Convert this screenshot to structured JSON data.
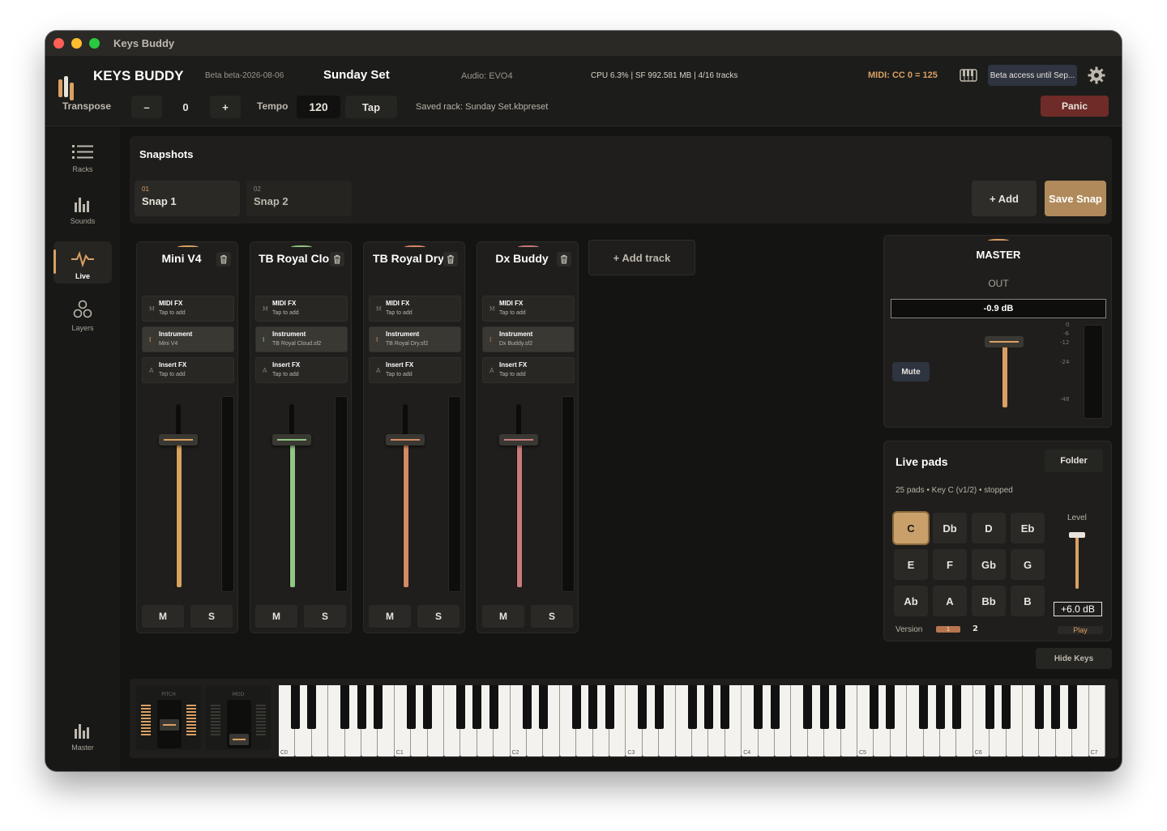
{
  "window": {
    "title": "Keys Buddy"
  },
  "header": {
    "brand": "KEYS BUDDY",
    "version": "Beta beta-2026-08-06",
    "set_name": "Sunday Set",
    "audio": "Audio: EVO4",
    "stats": "CPU 6.3% | SF 992.581 MB | 4/16 tracks",
    "midi": "MIDI: CC 0 = 125",
    "beta_button": "Beta access until Sep...",
    "transpose_label": "Transpose",
    "transpose_minus": "–",
    "transpose_value": "0",
    "transpose_plus": "+",
    "tempo_label": "Tempo",
    "tempo_value": "120",
    "tap_label": "Tap",
    "saved_rack": "Saved rack: Sunday Set.kbpreset",
    "panic_label": "Panic",
    "accent": "#d9a064",
    "panic_color": "#6e2b28"
  },
  "sidebar": {
    "items": [
      {
        "label": "Racks",
        "icon": "list-icon"
      },
      {
        "label": "Sounds",
        "icon": "bars-icon"
      },
      {
        "label": "Live",
        "icon": "pulse-icon"
      },
      {
        "label": "Layers",
        "icon": "layers-icon"
      }
    ],
    "master_label": "Master"
  },
  "snapshots": {
    "title": "Snapshots",
    "items": [
      {
        "num": "01",
        "name": "Snap 1"
      },
      {
        "num": "02",
        "name": "Snap 2"
      }
    ],
    "add_label": "+ Add",
    "save_label": "Save Snap"
  },
  "tracks": [
    {
      "name": "Mini V4",
      "color": "#d8a35f",
      "midi_fx": "MIDI FX",
      "midi_sub": "Tap to add",
      "instrument": "Instrument",
      "instrument_sub": "Mini V4",
      "insert_fx": "Insert FX",
      "insert_sub": "Tap to add",
      "m": "M",
      "s": "S",
      "level": 0.82
    },
    {
      "name": "TB Royal Cloud",
      "color": "#8fc683",
      "midi_fx": "MIDI FX",
      "midi_sub": "Tap to add",
      "instrument": "Instrument",
      "instrument_sub": "TB Royal Cloud.sf2",
      "insert_fx": "Insert FX",
      "insert_sub": "Tap to add",
      "m": "M",
      "s": "S",
      "level": 0.82
    },
    {
      "name": "TB Royal Dry",
      "color": "#d48a64",
      "midi_fx": "MIDI FX",
      "midi_sub": "Tap to add",
      "instrument": "Instrument",
      "instrument_sub": "TB Royal Dry.sf2",
      "insert_fx": "Insert FX",
      "insert_sub": "Tap to add",
      "m": "M",
      "s": "S",
      "level": 0.82
    },
    {
      "name": "Dx Buddy",
      "color": "#c97b7b",
      "midi_fx": "MIDI FX",
      "midi_sub": "Tap to add",
      "instrument": "Instrument",
      "instrument_sub": "Dx Buddy.sf2",
      "insert_fx": "Insert FX",
      "insert_sub": "Tap to add",
      "m": "M",
      "s": "S",
      "level": 0.82
    }
  ],
  "add_track": "+  Add track",
  "master": {
    "title": "MASTER",
    "out": "OUT",
    "db": "-0.9 dB",
    "mute": "Mute",
    "scale": [
      "0",
      "-6",
      "-12",
      "-24",
      "-48"
    ]
  },
  "livepads": {
    "title": "Live pads",
    "folder": "Folder",
    "info": "25 pads  •  Key C (v1/2)  •  stopped",
    "pads": [
      "C",
      "Db",
      "D",
      "Eb",
      "E",
      "F",
      "Gb",
      "G",
      "Ab",
      "A",
      "Bb",
      "B"
    ],
    "level_label": "Level",
    "level_value": "+6.0 dB",
    "version_label": "Version",
    "version_1": "1",
    "version_2": "2",
    "play": "Play"
  },
  "keyboard": {
    "hide_label": "Hide Keys",
    "pitch": "PITCH",
    "mod": "MOD",
    "octaves": [
      "C0",
      "C1",
      "C2",
      "C3",
      "C4",
      "C5",
      "C6",
      "C7"
    ]
  }
}
